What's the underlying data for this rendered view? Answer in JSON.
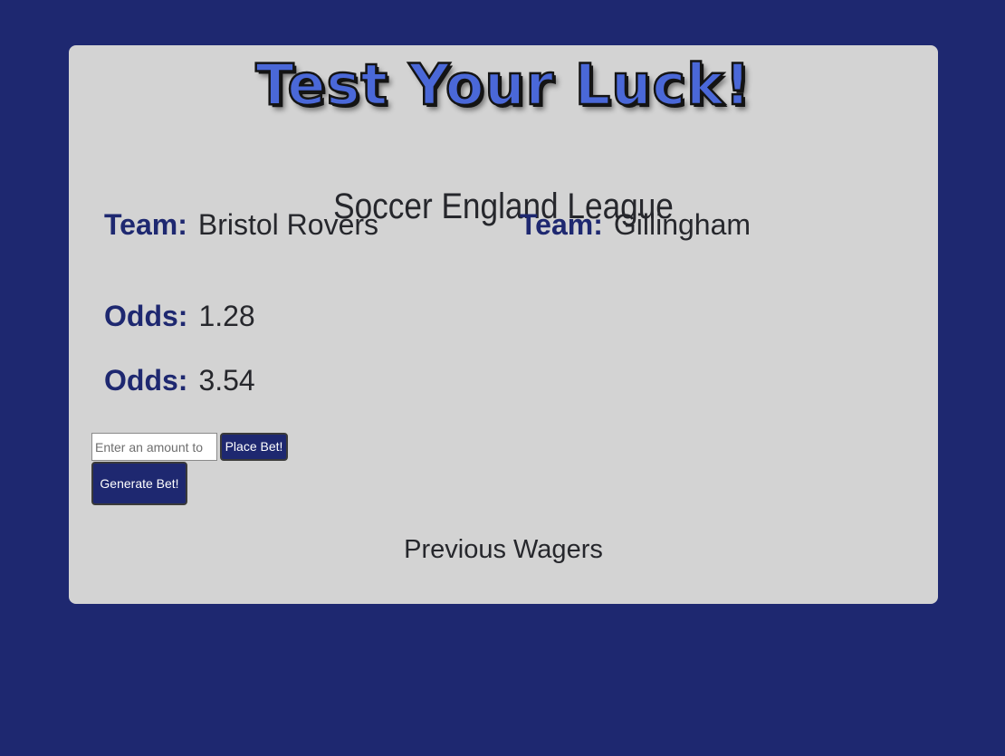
{
  "page": {
    "title": "Test Your Luck!",
    "league": "Soccer England League",
    "colors": {
      "background": "#1e2870",
      "card": "#d3d3d3",
      "title_fill": "#4a68d8",
      "label": "#1e2870",
      "text": "#26272c",
      "button": "#1e2870"
    }
  },
  "teams": [
    {
      "label": "Team:",
      "name": "Bristol Rovers"
    },
    {
      "label": "Team:",
      "name": "Gillingham"
    }
  ],
  "odds": [
    {
      "label": "Odds:",
      "value": "1.28"
    },
    {
      "label": "Odds:",
      "value": "3.54"
    }
  ],
  "bet": {
    "placeholder": "Enter an amount to",
    "value": "",
    "place_label": "Place Bet!",
    "generate_label": "Generate Bet!"
  },
  "wagers": {
    "heading": "Previous Wagers"
  }
}
